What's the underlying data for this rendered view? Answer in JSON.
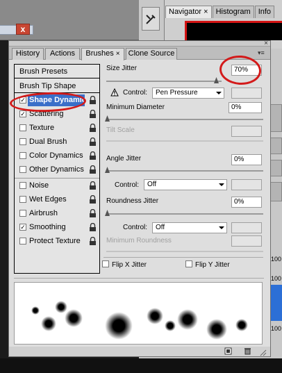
{
  "background": {
    "close_symbol": "x",
    "nav_tabs": [
      {
        "label": "Navigator",
        "close": "×",
        "active": true
      },
      {
        "label": "Histogram",
        "close": "",
        "active": false
      },
      {
        "label": "Info",
        "close": "",
        "active": false
      }
    ],
    "side_numbers": [
      "100",
      "100",
      "100"
    ]
  },
  "panel": {
    "close_symbol": "×",
    "menu_symbol": "▾≡",
    "tabs": [
      {
        "label": "History",
        "close": "",
        "active": false
      },
      {
        "label": "Actions",
        "close": "",
        "active": false
      },
      {
        "label": "Brushes",
        "close": "×",
        "active": true
      },
      {
        "label": "Clone Source",
        "close": "",
        "active": false
      }
    ],
    "left_list": {
      "brush_presets": "Brush Presets",
      "brush_tip_shape": "Brush Tip Shape",
      "items": [
        {
          "label": "Shape Dynamic",
          "checked": true,
          "selected": true
        },
        {
          "label": "Scattering",
          "checked": true,
          "selected": false
        },
        {
          "label": "Texture",
          "checked": false,
          "selected": false
        },
        {
          "label": "Dual Brush",
          "checked": false,
          "selected": false
        },
        {
          "label": "Color Dynamics",
          "checked": false,
          "selected": false
        },
        {
          "label": "Other Dynamics",
          "checked": false,
          "selected": false
        },
        {
          "label": "Noise",
          "checked": false,
          "selected": false
        },
        {
          "label": "Wet Edges",
          "checked": false,
          "selected": false
        },
        {
          "label": "Airbrush",
          "checked": false,
          "selected": false
        },
        {
          "label": "Smoothing",
          "checked": true,
          "selected": false
        },
        {
          "label": "Protect Texture",
          "checked": false,
          "selected": false
        }
      ],
      "check_mark": "✓"
    },
    "settings": {
      "size_jitter_label": "Size Jitter",
      "size_jitter_value": "70%",
      "size_jitter_level": 0.7,
      "control_label": "Control:",
      "control_value": "Pen Pressure",
      "min_diameter_label": "Minimum Diameter",
      "min_diameter_value": "0%",
      "tilt_scale_label": "Tilt Scale",
      "angle_jitter_label": "Angle Jitter",
      "angle_jitter_value": "0%",
      "angle_control_label": "Control:",
      "angle_control_value": "Off",
      "roundness_jitter_label": "Roundness Jitter",
      "roundness_jitter_value": "0%",
      "roundness_control_label": "Control:",
      "roundness_control_value": "Off",
      "min_roundness_label": "Minimum Roundness",
      "flip_x_label": "Flip X Jitter",
      "flip_y_label": "Flip Y Jitter"
    },
    "colors": {
      "selection": "#3a6fc9",
      "annotation": "#d31a1a"
    }
  }
}
